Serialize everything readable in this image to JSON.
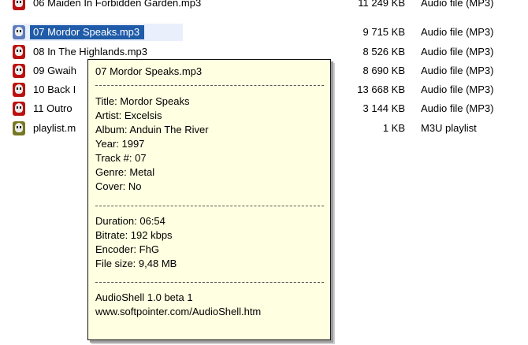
{
  "files": [
    {
      "name": "06 Maiden In Forbidden Garden.mp3",
      "size": "11 249 KB",
      "type": "Audio file (MP3)"
    },
    {
      "name": "07 Mordor Speaks.mp3",
      "size": "9 715 KB",
      "type": "Audio file (MP3)",
      "selected": true
    },
    {
      "name": "08 In The Highlands.mp3",
      "size": "8 526 KB",
      "type": "Audio file (MP3)"
    },
    {
      "name": "09 Gwaih",
      "size": "8 690 KB",
      "type": "Audio file (MP3)"
    },
    {
      "name": "10 Back I",
      "size": "13 668 KB",
      "type": "Audio file (MP3)"
    },
    {
      "name": "11 Outro",
      "size": "3 144 KB",
      "type": "Audio file (MP3)"
    },
    {
      "name": "playlist.m",
      "size": "1 KB",
      "type": "M3U playlist",
      "icon": "playlist-icon"
    }
  ],
  "tooltip": {
    "filename": "07 Mordor Speaks.mp3",
    "title": "Title: Mordor Speaks",
    "artist": "Artist: Excelsis",
    "album": "Album: Anduin The River",
    "year": "Year: 1997",
    "track": "Track #: 07",
    "genre": "Genre: Metal",
    "cover": "Cover: No",
    "duration": "Duration: 06:54",
    "bitrate": "Bitrate: 192 kbps",
    "encoder": "Encoder: FhG",
    "filesize": "File size: 9,48 MB",
    "app": "AudioShell 1.0 beta 1",
    "url": "www.softpointer.com/AudioShell.htm"
  },
  "icons": {
    "mp3": "mp3-file-icon",
    "playlist": "playlist-icon"
  },
  "colors": {
    "selection": "#1f5ba8",
    "tooltip_bg": "#ffffe1"
  }
}
